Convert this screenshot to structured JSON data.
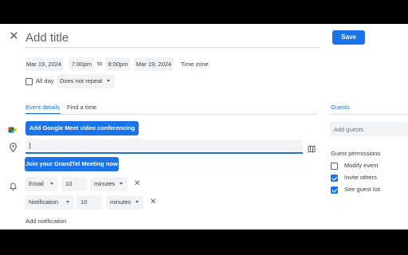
{
  "header": {
    "title_placeholder": "Add title",
    "save_label": "Save"
  },
  "datetime": {
    "start_date": "Mar 19, 2024",
    "start_time": "7:00pm",
    "to_label": "to",
    "end_time": "8:00pm",
    "end_date": "Mar 19, 2024",
    "timezone_label": "Time zone"
  },
  "options": {
    "all_day_label": "All day",
    "all_day_checked": false,
    "repeat_value": "Does not repeat"
  },
  "tabs": [
    {
      "label": "Event details",
      "active": true
    },
    {
      "label": "Find a time",
      "active": false
    }
  ],
  "details": {
    "meet_button_label": "Add Google Meet video conferencing",
    "location_value": "",
    "join_button_label": "Join your GrandTel Meeting now",
    "notifications": [
      {
        "type": "Email",
        "amount": "10",
        "unit": "minutes"
      },
      {
        "type": "Notification",
        "amount": "10",
        "unit": "minutes"
      }
    ],
    "add_notification_label": "Add notification"
  },
  "guests": {
    "heading": "Guests",
    "input_placeholder": "Add guests",
    "permissions_heading": "Guest permissions",
    "permissions": [
      {
        "label": "Modify event",
        "checked": false
      },
      {
        "label": "Invite others",
        "checked": true
      },
      {
        "label": "See guest list",
        "checked": true
      }
    ]
  },
  "colors": {
    "accent": "#1a73e8",
    "field_bg": "#f1f3f4",
    "text": "#3c4043"
  }
}
